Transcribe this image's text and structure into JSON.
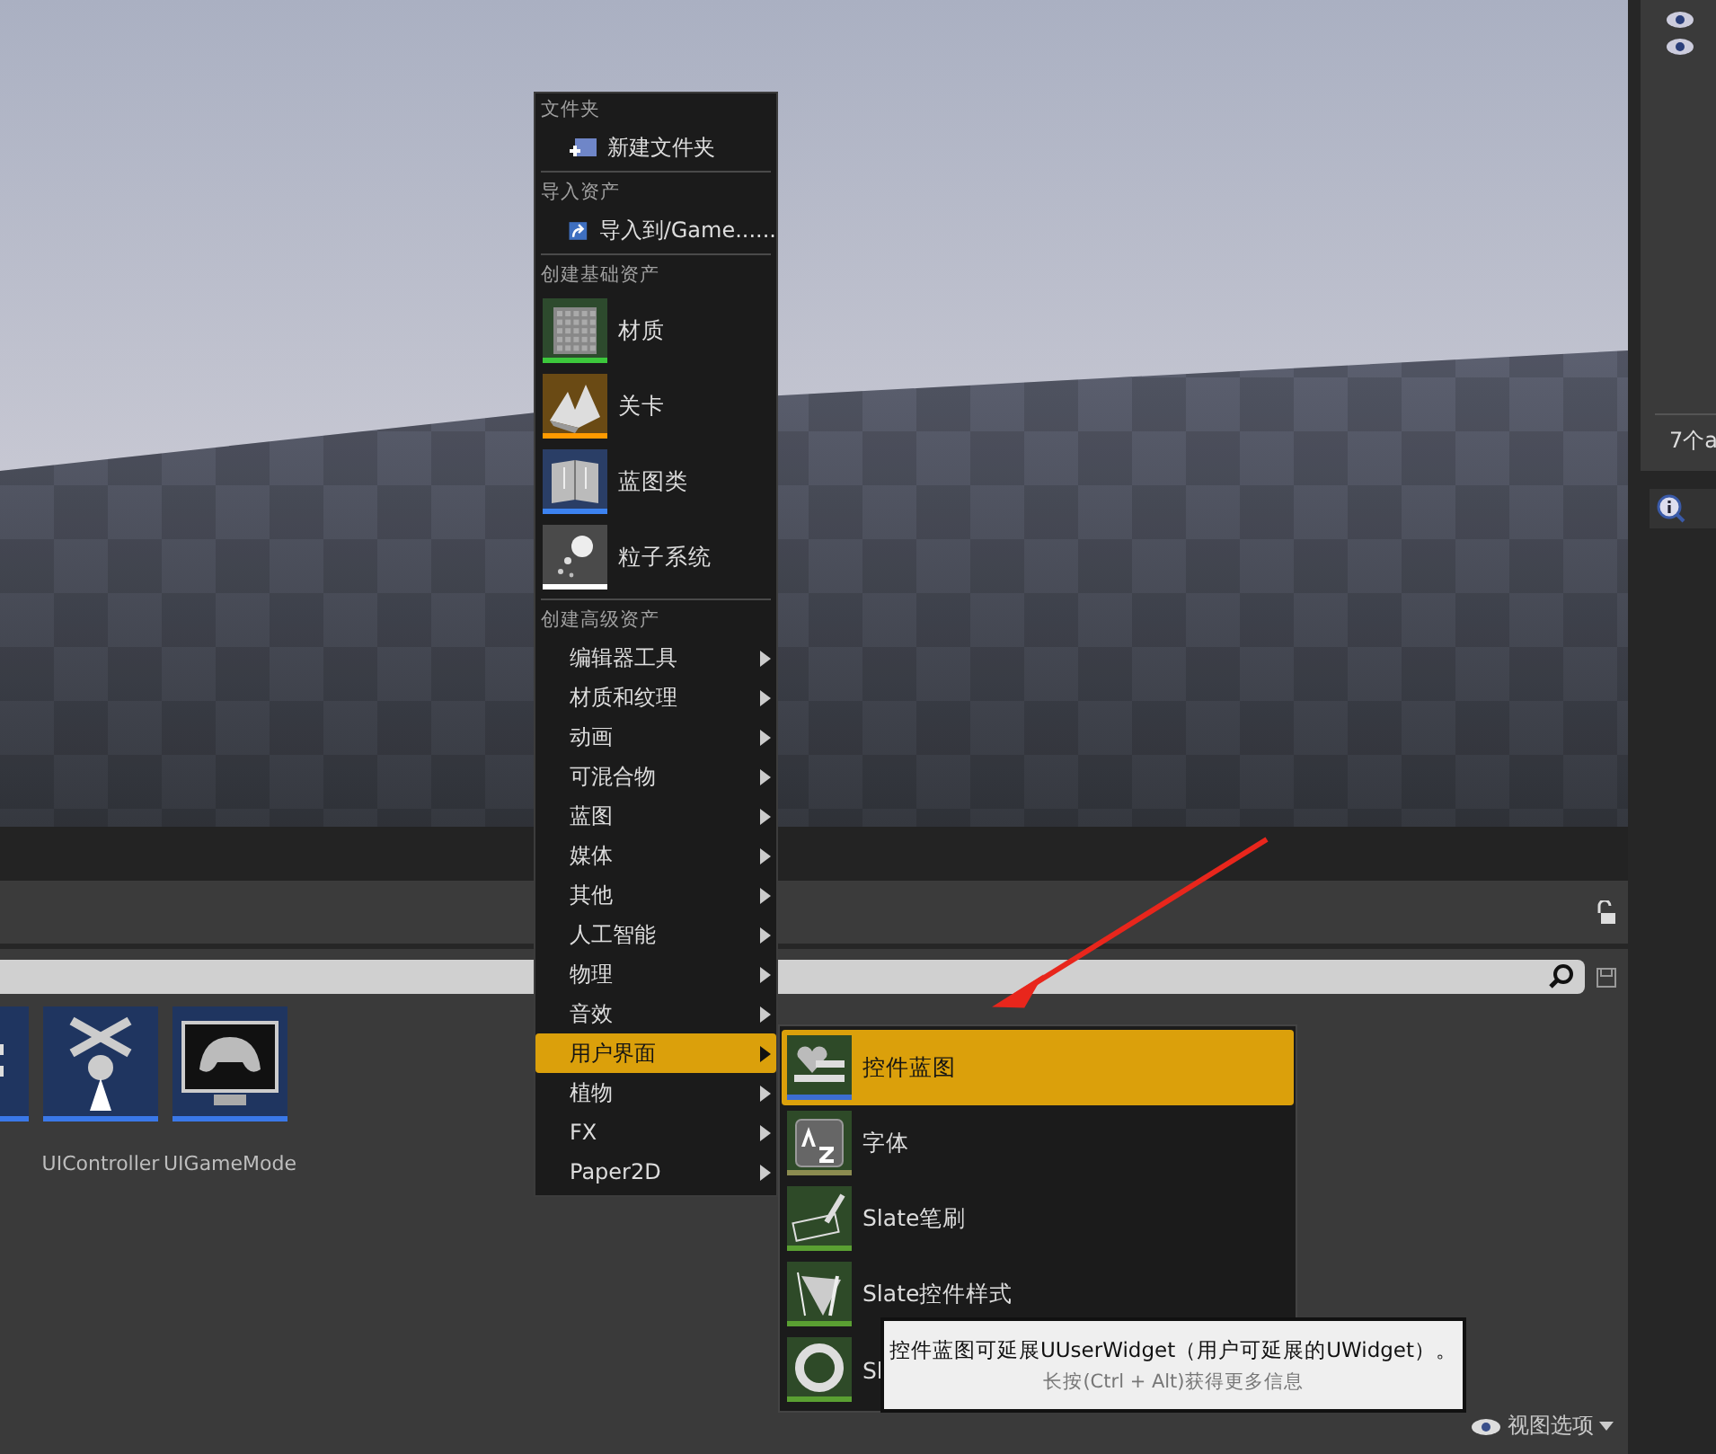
{
  "outliner": {
    "summary": "7个a"
  },
  "content_browser": {
    "assets": [
      {
        "name": "UIController"
      },
      {
        "name": "UIGameMode"
      }
    ],
    "view_options": "视图选项"
  },
  "context_menu": {
    "sections": [
      {
        "header": "文件夹",
        "items": [
          {
            "kind": "small",
            "label": "新建文件夹"
          }
        ]
      },
      {
        "header": "导入资产",
        "items": [
          {
            "kind": "small",
            "label": "导入到/Game......"
          }
        ]
      },
      {
        "header": "创建基础资产",
        "items": [
          {
            "kind": "asset",
            "label": "材质",
            "color": "#3cc83c"
          },
          {
            "kind": "asset",
            "label": "关卡",
            "color": "#ff9a00"
          },
          {
            "kind": "asset",
            "label": "蓝图类",
            "color": "#3c82f0"
          },
          {
            "kind": "asset",
            "label": "粒子系统",
            "color": "#ffffff"
          }
        ]
      },
      {
        "header": "创建高级资产",
        "items": [
          {
            "kind": "submenu",
            "label": "编辑器工具",
            "selected": false
          },
          {
            "kind": "submenu",
            "label": "材质和纹理",
            "selected": false
          },
          {
            "kind": "submenu",
            "label": "动画",
            "selected": false
          },
          {
            "kind": "submenu",
            "label": "可混合物",
            "selected": false
          },
          {
            "kind": "submenu",
            "label": "蓝图",
            "selected": false
          },
          {
            "kind": "submenu",
            "label": "媒体",
            "selected": false
          },
          {
            "kind": "submenu",
            "label": "其他",
            "selected": false
          },
          {
            "kind": "submenu",
            "label": "人工智能",
            "selected": false
          },
          {
            "kind": "submenu",
            "label": "物理",
            "selected": false
          },
          {
            "kind": "submenu",
            "label": "音效",
            "selected": false
          },
          {
            "kind": "submenu",
            "label": "用户界面",
            "selected": true
          },
          {
            "kind": "submenu",
            "label": "植物",
            "selected": false
          },
          {
            "kind": "submenu",
            "label": "FX",
            "selected": false
          },
          {
            "kind": "submenu",
            "label": "Paper2D",
            "selected": false
          }
        ]
      }
    ]
  },
  "submenu": {
    "items": [
      {
        "label": "控件蓝图",
        "color": "#3c6ed2",
        "selected": true
      },
      {
        "label": "字体",
        "color": "#8c8c50",
        "selected": false
      },
      {
        "label": "Slate笔刷",
        "color": "#5aa032",
        "selected": false
      },
      {
        "label": "Slate控件样式",
        "color": "#5aa032",
        "selected": false
      },
      {
        "label": "Sl",
        "color": "#5aa032",
        "selected": false
      }
    ]
  },
  "tooltip": {
    "text": "控件蓝图可延展UUserWidget（用户可延展的UWidget）。",
    "hint": "长按(Ctrl + Alt)获得更多信息"
  }
}
